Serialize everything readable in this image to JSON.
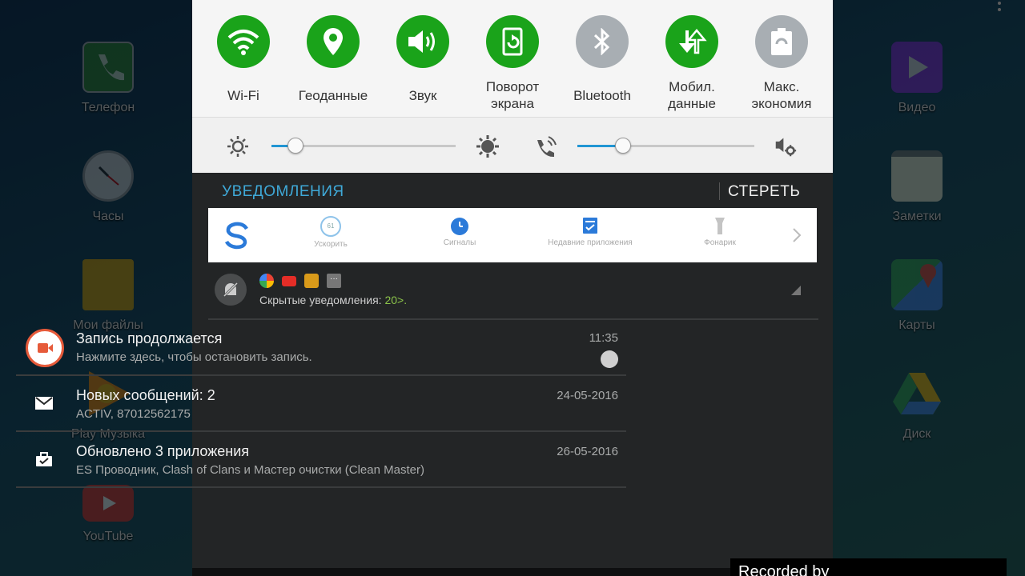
{
  "homescreen": {
    "left_apps": [
      {
        "label": "Телефон",
        "icon": "phone-icon",
        "color": "#2e8b2e"
      },
      {
        "label": "Часы",
        "icon": "clock-icon",
        "color": "#cccccc"
      },
      {
        "label": "Мои файлы",
        "icon": "folder-icon",
        "color": "#e0a800"
      },
      {
        "label": "Play Музыка",
        "icon": "play-music-icon",
        "color": "#ff8a00"
      },
      {
        "label": "YouTube",
        "icon": "youtube-icon",
        "color": "#e52d27"
      }
    ],
    "right_apps": [
      {
        "label": "Видео",
        "icon": "video-icon",
        "color": "#8a2be2"
      },
      {
        "label": "Заметки",
        "icon": "notes-icon",
        "color": "#f5f0d5"
      },
      {
        "label": "Карты",
        "icon": "maps-icon",
        "color": "#34a853"
      },
      {
        "label": "Диск",
        "icon": "drive-icon",
        "color": "#fbbc05"
      }
    ]
  },
  "quick_settings": [
    {
      "label": "Wi-Fi",
      "icon": "wifi-icon",
      "state": "on"
    },
    {
      "label": "Геоданные",
      "icon": "location-icon",
      "state": "on"
    },
    {
      "label": "Звук",
      "icon": "sound-icon",
      "state": "on"
    },
    {
      "label": "Поворот\nэкрана",
      "icon": "rotate-icon",
      "state": "on"
    },
    {
      "label": "Bluetooth",
      "icon": "bluetooth-icon",
      "state": "off"
    },
    {
      "label": "Мобил.\nданные",
      "icon": "mobile-data-icon",
      "state": "on"
    },
    {
      "label": "Макс.\nэкономия",
      "icon": "battery-saver-icon",
      "state": "off"
    }
  ],
  "sliders": {
    "brightness_level": 0.13,
    "volume_level": 0.26
  },
  "notifications_header": {
    "title": "УВЕДОМЛЕНИЯ",
    "clear": "СТЕРЕТЬ"
  },
  "clean_toolbar": {
    "items": [
      {
        "label": "Ускорить",
        "icon": "boost-icon",
        "badge": "61"
      },
      {
        "label": "Сигналы",
        "icon": "alarm-icon"
      },
      {
        "label": "Недавние приложения",
        "icon": "recent-apps-icon"
      },
      {
        "label": "Фонарик",
        "icon": "flashlight-icon"
      }
    ]
  },
  "hidden": {
    "text": "Скрытые уведомления: ",
    "count": "20>."
  },
  "notifications": [
    {
      "title": "Запись продолжается",
      "subtitle": "Нажмите здесь, чтобы остановить запись.",
      "time": "11:35",
      "icon": "record-icon"
    },
    {
      "title": "Новых сообщений: 2",
      "subtitle": "ACTIV, 87012562175",
      "time": "24-05-2016",
      "icon": "mail-icon"
    },
    {
      "title": "Обновлено 3 приложения",
      "subtitle": "ES Проводник, Clash of Clans и Мастер очистки (Clean Master)",
      "time": "26-05-2016",
      "icon": "update-icon"
    }
  ],
  "watermark": "Recorded by"
}
